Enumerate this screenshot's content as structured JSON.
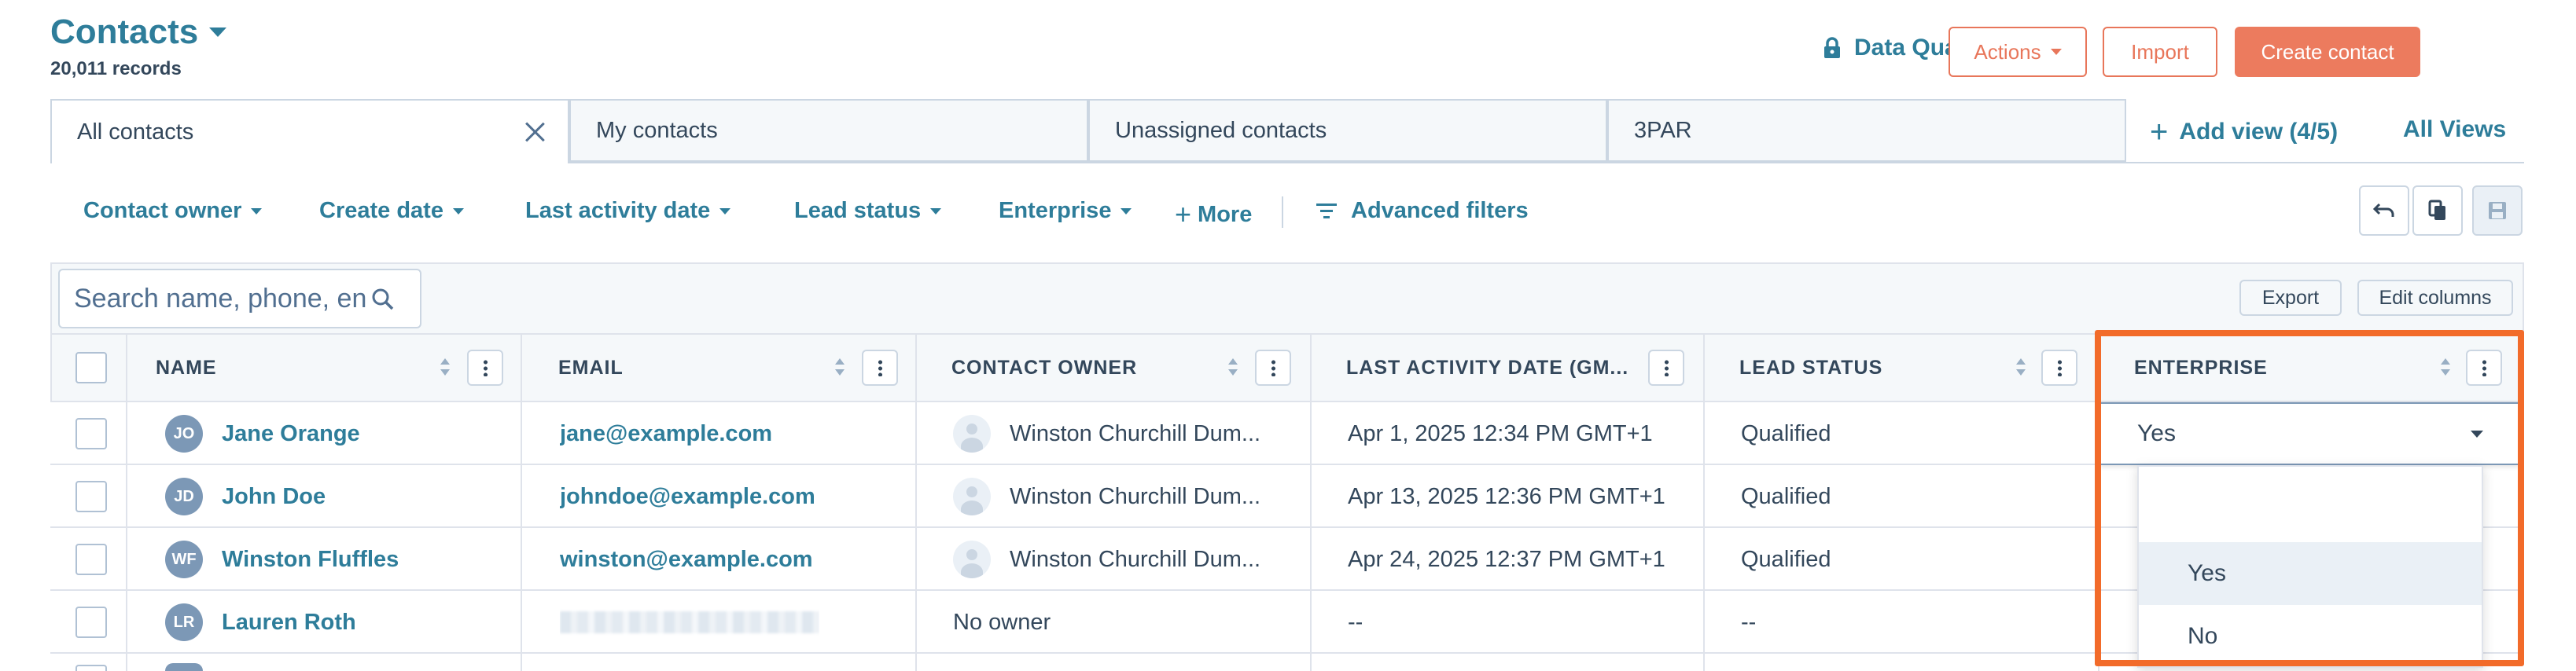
{
  "header": {
    "title": "Contacts",
    "records": "20,011 records",
    "data_quality": "Data Quality",
    "actions": "Actions",
    "import": "Import",
    "create": "Create contact"
  },
  "tabs": [
    {
      "label": "All contacts"
    },
    {
      "label": "My contacts"
    },
    {
      "label": "Unassigned contacts"
    },
    {
      "label": "3PAR"
    }
  ],
  "views": {
    "add": "Add view (4/5)",
    "all": "All Views"
  },
  "filters": {
    "contact_owner": "Contact owner",
    "create_date": "Create date",
    "last_activity": "Last activity date",
    "lead_status": "Lead status",
    "enterprise": "Enterprise",
    "more": "More",
    "advanced": "Advanced filters"
  },
  "search": {
    "placeholder": "Search name, phone, en"
  },
  "toolbar": {
    "export": "Export",
    "edit_columns": "Edit columns"
  },
  "columns": {
    "name": "NAME",
    "email": "EMAIL",
    "owner": "CONTACT OWNER",
    "last_activity": "LAST ACTIVITY DATE (GM...",
    "lead_status": "LEAD STATUS",
    "enterprise": "ENTERPRISE"
  },
  "rows": [
    {
      "initials": "JO",
      "name": "Jane Orange",
      "email": "jane@example.com",
      "owner": "Winston Churchill Dum...",
      "last_activity": "Apr 1, 2025 12:34 PM GMT+1",
      "lead_status": "Qualified"
    },
    {
      "initials": "JD",
      "name": "John Doe",
      "email": "johndoe@example.com",
      "owner": "Winston Churchill Dum...",
      "last_activity": "Apr 13, 2025 12:36 PM GMT+1",
      "lead_status": "Qualified"
    },
    {
      "initials": "WF",
      "name": "Winston Fluffles",
      "email": "winston@example.com",
      "owner": "Winston Churchill Dum...",
      "last_activity": "Apr 24, 2025 12:37 PM GMT+1",
      "lead_status": "Qualified"
    },
    {
      "initials": "LR",
      "name": "Lauren Roth",
      "email": "",
      "owner": "No owner",
      "last_activity": "--",
      "lead_status": "--"
    }
  ],
  "enterprise_select": {
    "value": "Yes",
    "options": [
      "",
      "Yes",
      "No"
    ]
  },
  "colors": {
    "accent": "#2e7d9a",
    "cta": "#ec7b5e",
    "highlight": "#f26b2a"
  }
}
